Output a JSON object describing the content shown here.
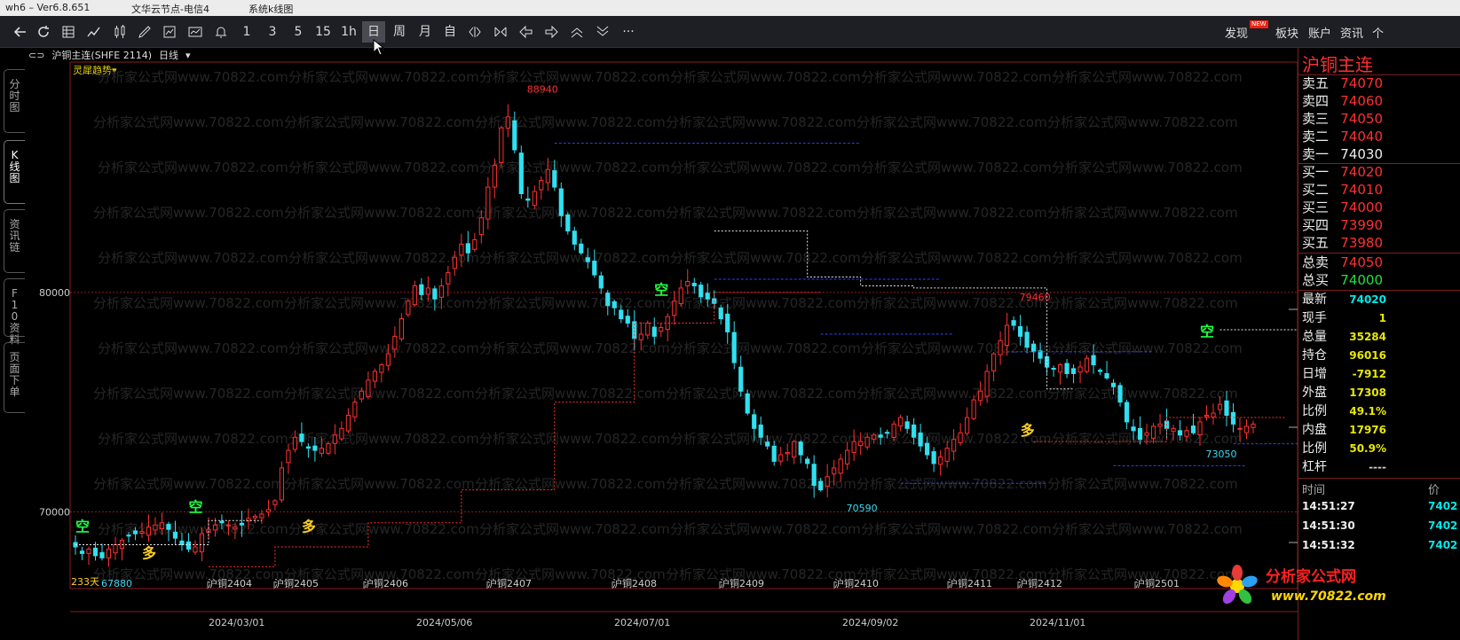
{
  "window": {
    "version": "wh6 – Ver6.8.651",
    "node": "文华云节点-电信4",
    "menu": "系统k线图"
  },
  "toolbar": {
    "periods": [
      "1",
      "3",
      "5",
      "15",
      "1h",
      "日",
      "周",
      "月",
      "自"
    ],
    "selected_period": "日",
    "right_items": [
      "发现",
      "板块",
      "账户",
      "资讯",
      "个"
    ],
    "new_badge": "NEW"
  },
  "left_tabs": [
    "分时图",
    "K线图",
    "资讯链",
    "F10资料",
    "页面下单"
  ],
  "chart_header": {
    "contract": "沪铜主连(SHFE 2114)",
    "period": "日线",
    "indicator": "灵犀趋势"
  },
  "price_panel": {
    "title": "沪铜主连",
    "asks": [
      {
        "label": "卖五",
        "value": "74070"
      },
      {
        "label": "卖四",
        "value": "74060"
      },
      {
        "label": "卖三",
        "value": "74050"
      },
      {
        "label": "卖二",
        "value": "74040"
      },
      {
        "label": "卖一",
        "value": "74030"
      }
    ],
    "bids": [
      {
        "label": "买一",
        "value": "74020"
      },
      {
        "label": "买二",
        "value": "74010"
      },
      {
        "label": "买三",
        "value": "74000"
      },
      {
        "label": "买四",
        "value": "73990"
      },
      {
        "label": "买五",
        "value": "73980"
      }
    ],
    "totals": [
      {
        "label": "总卖",
        "value": "74050"
      },
      {
        "label": "总买",
        "value": "74000"
      }
    ],
    "stats": [
      {
        "label": "最新",
        "value": "74020",
        "color": "#00e8e8"
      },
      {
        "label": "现手",
        "value": "1",
        "color": "#e8e800"
      },
      {
        "label": "总量",
        "value": "35284",
        "color": "#e8e800"
      },
      {
        "label": "持仓",
        "value": "96016",
        "color": "#e8e800"
      },
      {
        "label": "日增",
        "value": "-7912",
        "color": "#e8e800"
      },
      {
        "label": "外盘",
        "value": "17308",
        "color": "#e8e800"
      },
      {
        "label": "比例",
        "value": "49.1%",
        "color": "#e8e800"
      },
      {
        "label": "内盘",
        "value": "17976",
        "color": "#e8e800"
      },
      {
        "label": "比例",
        "value": "50.9%",
        "color": "#e8e800"
      },
      {
        "label": "杠杆",
        "value": "----",
        "color": "#cccccc"
      }
    ],
    "ticks_header": [
      "时间",
      "价"
    ],
    "ticks": [
      {
        "time": "14:51:27",
        "price": "7402"
      },
      {
        "time": "14:51:30",
        "price": "7402"
      },
      {
        "time": "14:51:32",
        "price": "7402"
      }
    ]
  },
  "watermark": "分析家公式网www.70822.com",
  "logo": {
    "name": "分析家公式网",
    "url": "www.70822.com"
  },
  "chart_data": {
    "type": "candlestick",
    "ylim": [
      66500,
      90500
    ],
    "y_ticks": [
      80000,
      70000
    ],
    "count_label": "233天",
    "low_label_left": "67880",
    "bottom_dates": [
      "2024/03/01",
      "2024/05/06",
      "2024/07/01",
      "2024/09/02",
      "2024/11/01"
    ],
    "contract_markers": [
      "沪铜2404",
      "沪铜2405",
      "沪铜2406",
      "沪铜2407",
      "沪铜2408",
      "沪铜2409",
      "沪铜2410",
      "沪铜2411",
      "沪铜2412",
      "沪铜2501"
    ],
    "annotations": [
      {
        "text": "88940",
        "price": 88940,
        "color": "#ff3030"
      },
      {
        "text": "79460",
        "price": 79460,
        "color": "#ff3030"
      },
      {
        "text": "70590",
        "price": 70590,
        "color": "#40d8f0"
      },
      {
        "text": "73050",
        "price": 73050,
        "color": "#40d8f0"
      }
    ],
    "signals": [
      {
        "text": "空",
        "color": "#20ff40"
      },
      {
        "text": "多",
        "color": "#ffd020"
      },
      {
        "text": "空",
        "color": "#20ff40"
      },
      {
        "text": "多",
        "color": "#ffd020"
      },
      {
        "text": "空",
        "color": "#20ff40"
      },
      {
        "text": "多",
        "color": "#ffd020"
      },
      {
        "text": "空",
        "color": "#20ff40"
      }
    ],
    "closes": [
      68400,
      68100,
      68300,
      68000,
      67900,
      68300,
      68500,
      68700,
      68900,
      69000,
      69100,
      69300,
      69400,
      69500,
      69200,
      68800,
      68500,
      68300,
      68400,
      69000,
      69200,
      69400,
      69500,
      69400,
      69300,
      69400,
      69700,
      69800,
      69900,
      70100,
      70500,
      72000,
      72800,
      73400,
      73200,
      72900,
      72800,
      72900,
      73100,
      73500,
      73800,
      74400,
      75000,
      75500,
      76000,
      76400,
      76700,
      77200,
      78000,
      78800,
      79600,
      80300,
      79900,
      80200,
      79700,
      80300,
      80900,
      81600,
      82200,
      81800,
      82400,
      83400,
      84800,
      85800,
      87500,
      88000,
      86500,
      84500,
      84200,
      84600,
      85100,
      85600,
      84800,
      83500,
      82800,
      82200,
      81800,
      81400,
      80800,
      80200,
      79400,
      79300,
      78800,
      78600,
      77900,
      78100,
      78600,
      78000,
      78400,
      78900,
      79600,
      80200,
      80500,
      80300,
      79800,
      79700,
      79500,
      78800,
      78200,
      76800,
      75500,
      74500,
      73800,
      73400,
      73000,
      72300,
      72600,
      72700,
      73200,
      72600,
      72200,
      71200,
      71000,
      71600,
      72000,
      72400,
      72800,
      73200,
      73200,
      73400,
      73500,
      73400,
      73600,
      74000,
      74300,
      73800,
      73400,
      73000,
      72600,
      72200,
      72500,
      72900,
      73300,
      73600,
      74300,
      75100,
      75500,
      76400,
      77200,
      77800,
      78500,
      78500,
      78000,
      77500,
      77300,
      77000,
      76600,
      76500,
      76700,
      76300,
      76300,
      76600,
      77000,
      76700,
      76400,
      76100,
      75700,
      75000,
      74100,
      73700,
      73300,
      73600,
      73900,
      74000,
      73800,
      73800,
      73500,
      73700,
      73600,
      74100,
      74400,
      74500,
      74900,
      74400,
      74000,
      73800,
      73900,
      74000
    ]
  }
}
